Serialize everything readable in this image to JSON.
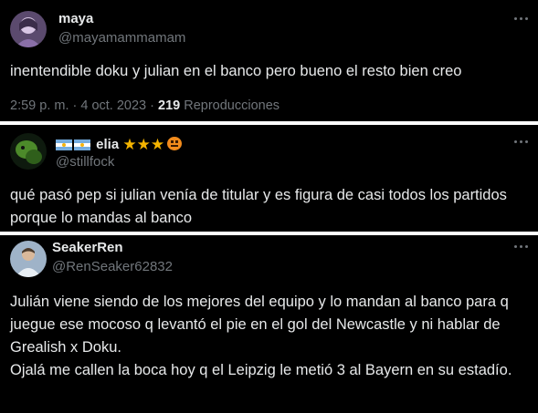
{
  "tweets": [
    {
      "name": "maya",
      "handle": "@mayamammamam",
      "text": "inentendible doku y julian en el banco pero bueno el resto bien creo",
      "time": "2:59 p. m. · 4 oct. 2023 · ",
      "views_count": "219",
      "views_label": " Reproducciones",
      "avatar_icon": "avatar-purple-anime"
    },
    {
      "name": "elia",
      "handle": "@stillfock",
      "text": "qué pasó pep si julian venía de titular y es figura de casi todos los partidos porque lo mandas al banco",
      "stars": "★★★",
      "avatar_icon": "avatar-green-character"
    },
    {
      "name": "SeakerRen",
      "handle": "@RenSeaker62832",
      "text": "Julián viene siendo de los mejores del equipo y lo mandan al banco para q juegue ese mocoso q levantó el pie en el gol del Newcastle y ni hablar de Grealish x Doku.\nOjalá me callen la boca hoy q el Leipzig le metió 3 al Bayern en su estadío.",
      "avatar_icon": "avatar-player-photo"
    }
  ],
  "colors": {
    "background": "#000000",
    "text": "#e7e9ea",
    "secondary": "#71767b",
    "separator": "#ffffff"
  }
}
